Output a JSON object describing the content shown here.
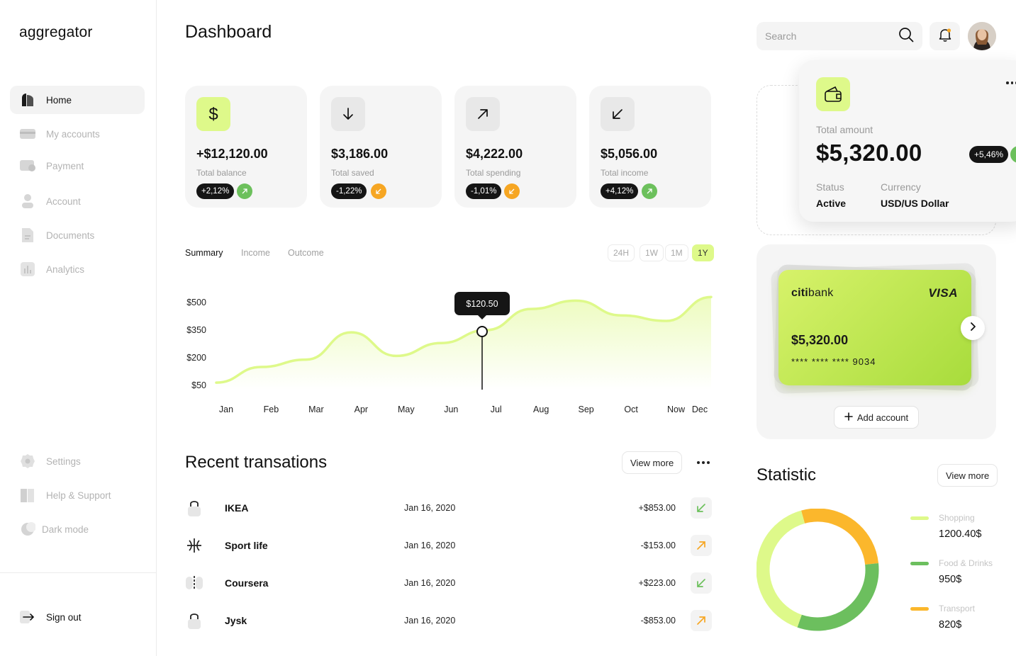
{
  "app": {
    "logo": "aggregator"
  },
  "sidebar": {
    "items": [
      {
        "label": "Home",
        "icon": "home-icon"
      },
      {
        "label": "My accounts",
        "icon": "wallet-card-icon"
      },
      {
        "label": "Payment",
        "icon": "payment-card-icon"
      },
      {
        "label": "Account",
        "icon": "user-icon"
      },
      {
        "label": "Documents",
        "icon": "document-icon"
      },
      {
        "label": "Analytics",
        "icon": "bar-chart-icon"
      }
    ],
    "bottom_items": [
      {
        "label": "Settings",
        "icon": "gear-icon"
      },
      {
        "label": "Help & Support",
        "icon": "book-icon"
      },
      {
        "label": "Dark mode",
        "icon": "moon-icon"
      }
    ],
    "sign_out": "Sign out"
  },
  "header": {
    "title": "Dashboard",
    "search_placeholder": "Search"
  },
  "stats": [
    {
      "value": "+$12,120.00",
      "label": "Total balance",
      "change": "+2,12%",
      "trend": "up",
      "icon": "dollar-icon"
    },
    {
      "value": "$3,186.00",
      "label": "Total saved",
      "change": "-1,22%",
      "trend": "down",
      "icon": "arrow-down-icon"
    },
    {
      "value": "$4,222.00",
      "label": "Total spending",
      "change": "-1,01%",
      "trend": "down",
      "icon": "arrow-up-right-icon"
    },
    {
      "value": "$5,056.00",
      "label": "Total income",
      "change": "+4,12%",
      "trend": "up",
      "icon": "arrow-down-left-icon"
    }
  ],
  "chart_tabs": [
    "Summary",
    "Income",
    "Outcome"
  ],
  "chart_ranges": [
    "24H",
    "1W",
    "1M",
    "1Y"
  ],
  "chart_data": {
    "type": "area",
    "categories": [
      "Jan",
      "Feb",
      "Mar",
      "Apr",
      "May",
      "Jun",
      "Jul",
      "Aug",
      "Sep",
      "Oct",
      "Now",
      "Dec"
    ],
    "values": [
      65,
      150,
      190,
      338,
      210,
      280,
      350,
      465,
      510,
      430,
      400,
      530
    ],
    "yticks": [
      "$500",
      "$350",
      "$200",
      "$50"
    ],
    "ytick_values": [
      500,
      350,
      200,
      50
    ],
    "ylim": [
      50,
      500
    ],
    "tooltip": {
      "label": "$120.50",
      "category": "Jul"
    },
    "accent": "#def98a"
  },
  "transactions": {
    "title": "Recent transations",
    "view_more": "View more",
    "rows": [
      {
        "name": "IKEA",
        "date": "Jan 16, 2020",
        "amount": "+$853.00",
        "direction": "in",
        "icon": "lock-logo-icon"
      },
      {
        "name": "Sport life",
        "date": "Jan 16, 2020",
        "amount": "-$153.00",
        "direction": "out",
        "icon": "sport-logo-icon"
      },
      {
        "name": "Coursera",
        "date": "Jan 16, 2020",
        "amount": "+$223.00",
        "direction": "in",
        "icon": "coursera-logo-icon"
      },
      {
        "name": "Jysk",
        "date": "Jan 16, 2020",
        "amount": "-$853.00",
        "direction": "out",
        "icon": "lock-logo-icon"
      }
    ]
  },
  "amount_card": {
    "label": "Total amount",
    "value": "$5,320.00",
    "change": "+5,46%",
    "status_label": "Status",
    "status_value": "Active",
    "currency_label": "Currency",
    "currency_value": "USD/US Dollar"
  },
  "bank_card": {
    "bank_prefix": "citi",
    "bank_suffix": "bank",
    "brand": "VISA",
    "balance": "$5,320.00",
    "number": "**** **** **** 9034",
    "add_account": "Add account"
  },
  "statistic": {
    "title": "Statistic",
    "view_more": "View more",
    "segments": [
      {
        "name": "Shopping",
        "value": "1200.40$",
        "amount": 1200.4,
        "color": "#def98a"
      },
      {
        "name": "Food & Drinks",
        "value": "950$",
        "amount": 950,
        "color": "#6cbf5e"
      },
      {
        "name": "Transport",
        "value": "820$",
        "amount": 820,
        "color": "#fbb72c"
      }
    ]
  },
  "colors": {
    "accent": "#def98a",
    "positive": "#6cc05c",
    "negative": "#f6a623",
    "dark": "#151515"
  }
}
